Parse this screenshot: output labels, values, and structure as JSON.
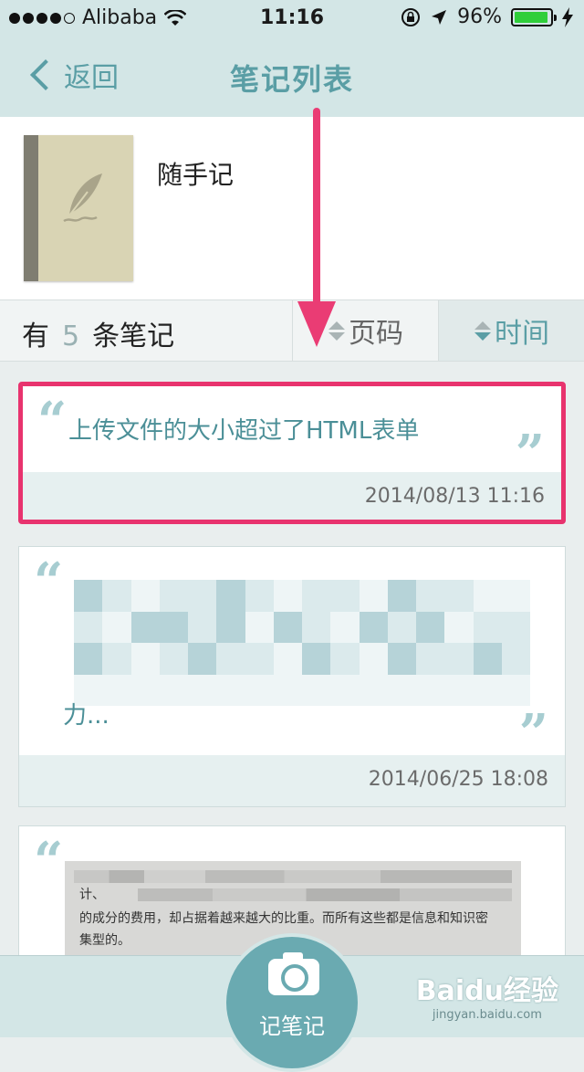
{
  "status_bar": {
    "carrier": "Alibaba",
    "time": "11:16",
    "battery": "96%",
    "battery_level": 0.96
  },
  "nav": {
    "back_label": "返回",
    "title": "笔记列表"
  },
  "notebook": {
    "name": "随手记"
  },
  "sort_bar": {
    "count_prefix": "有",
    "count": "5",
    "count_suffix": "条笔记",
    "sort_page_label": "页码",
    "sort_time_label": "时间"
  },
  "notes": [
    {
      "title": "上传文件的大小超过了HTML表单",
      "date": "2014/08/13 11:16"
    },
    {
      "title": "力...",
      "date": "2014/06/25 18:08"
    },
    {
      "title": "计、",
      "photo_lines": [
        "的成分的费用，却占据着越来越大的比重。而所有这些都是信息和知识密",
        "集型的。"
      ]
    }
  ],
  "tabbar": {
    "record_label": "记笔记"
  },
  "watermark": {
    "brand": "Baidu经验",
    "url": "jingyan.baidu.com"
  },
  "colors": {
    "accent": "#5a9ea5",
    "highlight": "#e8336e",
    "arrow": "#ea3c74"
  }
}
